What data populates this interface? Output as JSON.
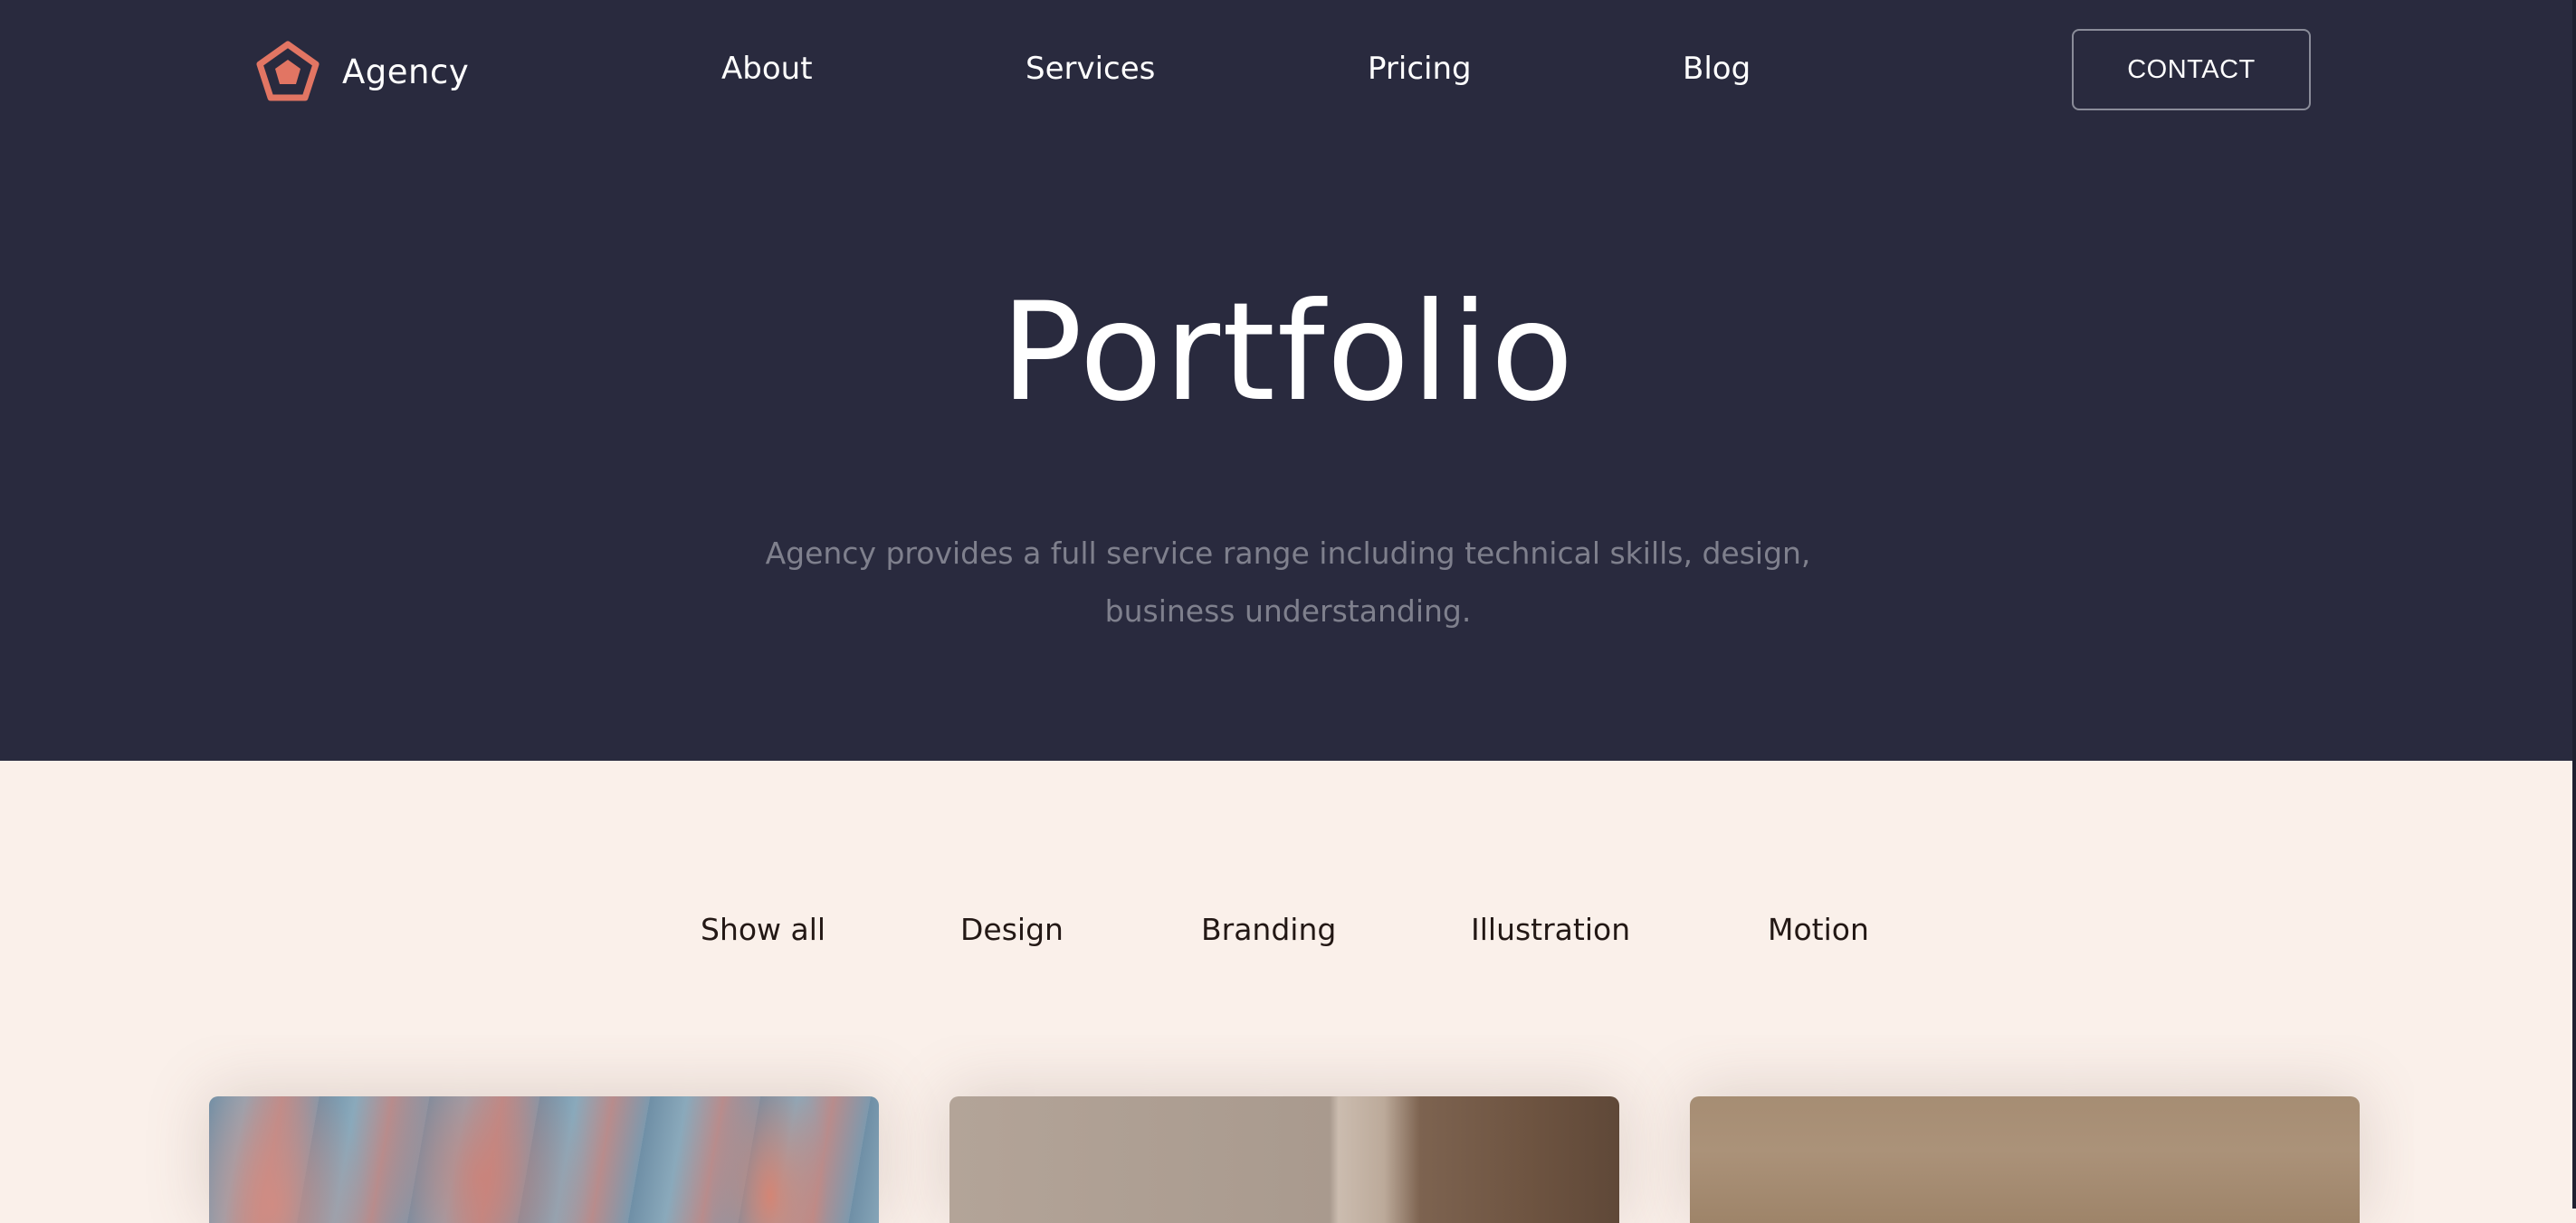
{
  "brand": {
    "name": "Agency",
    "logo_icon": "pentagon-icon",
    "accent_color": "#e27563"
  },
  "nav": {
    "links": [
      "About",
      "Services",
      "Pricing",
      "Blog"
    ],
    "contact_label": "CONTACT"
  },
  "hero": {
    "title": "Portfolio",
    "description": "Agency provides a full service range including technical skills, design, business understanding.",
    "background_color": "#292a3e"
  },
  "filters": [
    "Show all",
    "Design",
    "Branding",
    "Illustration",
    "Motion"
  ],
  "portfolio": {
    "background_color": "#faf0ea",
    "visible_cards": 3
  }
}
